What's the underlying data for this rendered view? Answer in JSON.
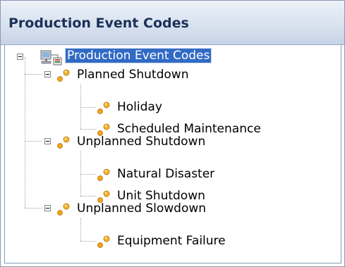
{
  "panel": {
    "title": "Production Event Codes"
  },
  "tree": {
    "root": {
      "label": "Production Event Codes",
      "icon": "production-root-icon",
      "selected": true,
      "expanded": true
    },
    "groups": [
      {
        "label": "Planned Shutdown",
        "icon": "event-code-icon",
        "expanded": true,
        "children": [
          {
            "label": "Holiday",
            "icon": "event-code-icon"
          },
          {
            "label": "Scheduled Maintenance",
            "icon": "event-code-icon"
          }
        ]
      },
      {
        "label": "Unplanned Shutdown",
        "icon": "event-code-icon",
        "expanded": true,
        "children": [
          {
            "label": "Natural Disaster",
            "icon": "event-code-icon"
          },
          {
            "label": "Unit Shutdown",
            "icon": "event-code-icon"
          }
        ]
      },
      {
        "label": "Unplanned Slowdown",
        "icon": "event-code-icon",
        "expanded": true,
        "children": [
          {
            "label": "Equipment Failure",
            "icon": "event-code-icon"
          }
        ]
      }
    ]
  },
  "colors": {
    "selection": "#316ac5",
    "header_text": "#1b3158",
    "node_icon": "#f2a51a"
  }
}
